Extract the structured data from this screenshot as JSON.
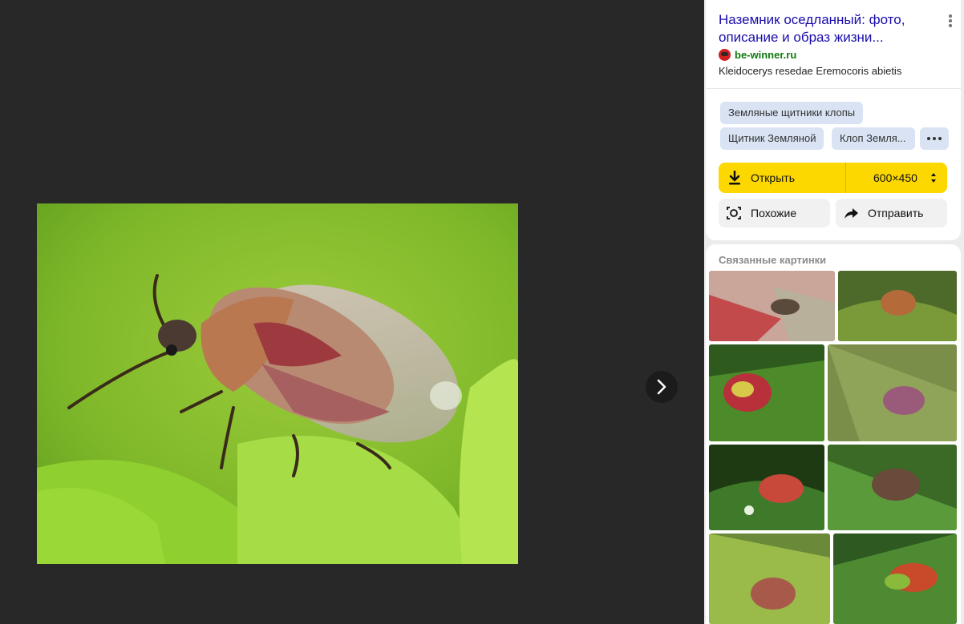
{
  "result": {
    "title": "Наземник оседланный: фото, описание и образ жизни...",
    "source": "be-winner.ru",
    "description": "Kleidocerys resedae Eremocoris abietis"
  },
  "tags": [
    "Земляные щитники клопы",
    "Щитник Земляной",
    "Клоп Земля..."
  ],
  "actions": {
    "open_label": "Открыть",
    "size_label": "600×450",
    "similar_label": "Похожие",
    "share_label": "Отправить"
  },
  "related": {
    "title": "Связанные картинки"
  },
  "icons": {
    "next": "chevron-right-icon",
    "menu": "vertical-dots-icon",
    "download": "download-icon",
    "similar": "camera-search-icon",
    "share": "share-arrow-icon",
    "more_tags": "horizontal-dots-icon"
  },
  "colors": {
    "viewer_bg": "#282828",
    "panel_bg": "#ececec",
    "title_link": "#1a0dab",
    "source_green": "#0e7a0e",
    "open_button": "#fcd800",
    "tag_bg": "#d9e3f4"
  }
}
